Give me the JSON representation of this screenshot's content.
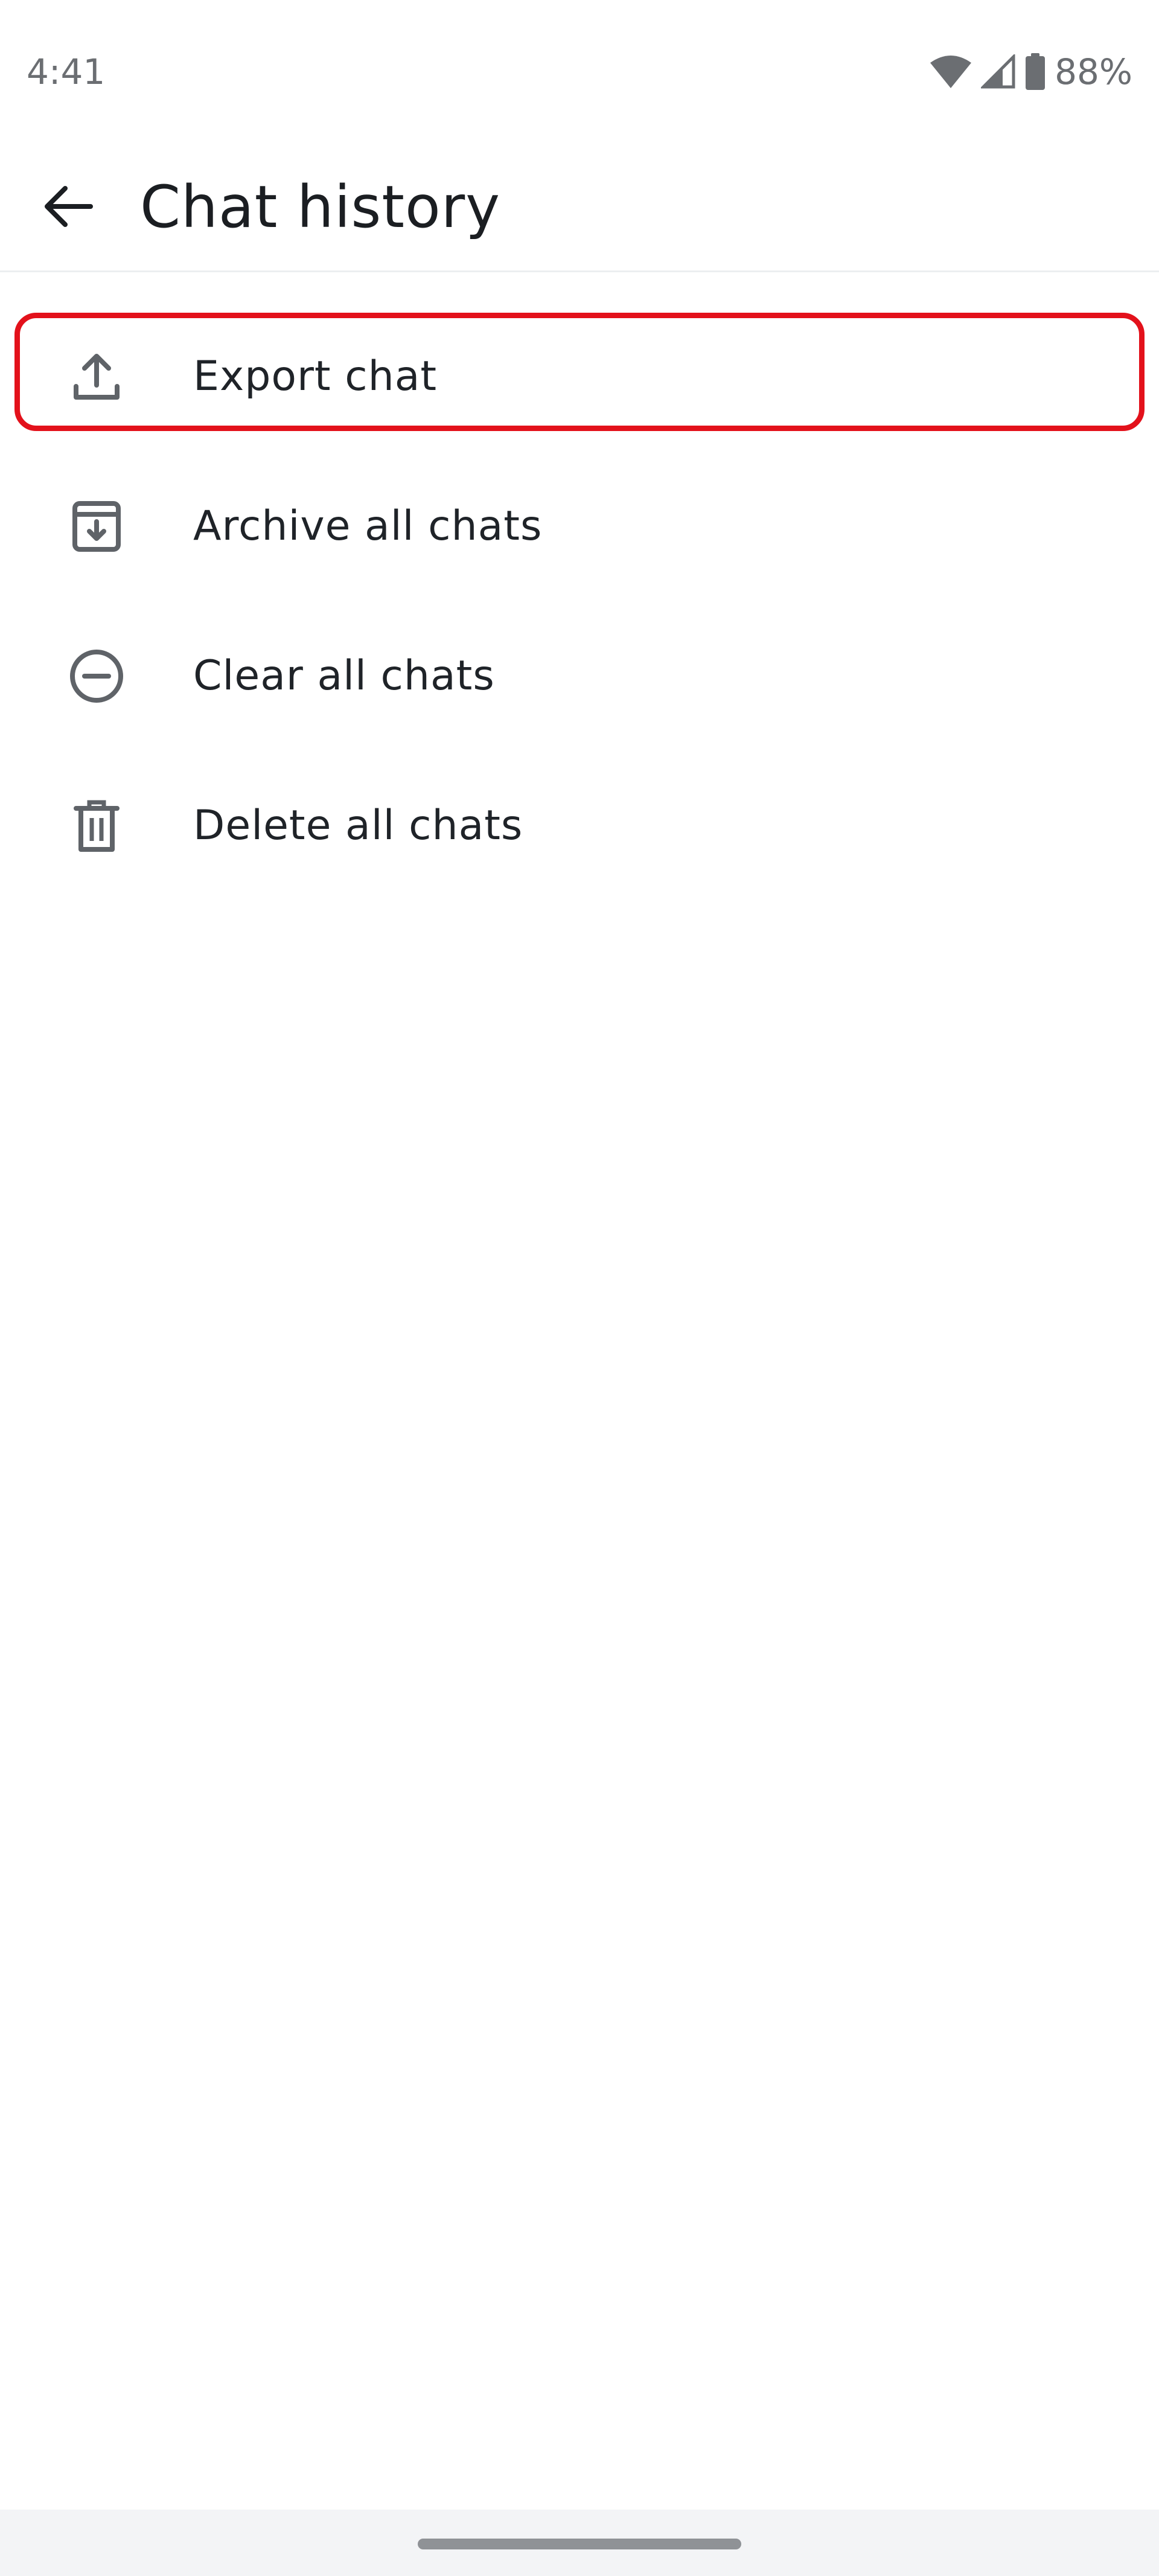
{
  "status_bar": {
    "time": "4:41",
    "battery_percent": "88%",
    "icons": [
      "wifi-icon",
      "cellular-signal-icon",
      "battery-icon"
    ]
  },
  "app_bar": {
    "back_icon": "arrow-left-icon",
    "title": "Chat history"
  },
  "menu": {
    "items": [
      {
        "icon": "upload-icon",
        "label": "Export chat",
        "highlighted": true
      },
      {
        "icon": "archive-icon",
        "label": "Archive all chats",
        "highlighted": false
      },
      {
        "icon": "minus-circle-icon",
        "label": "Clear all chats",
        "highlighted": false
      },
      {
        "icon": "trash-icon",
        "label": "Delete all chats",
        "highlighted": false
      }
    ]
  },
  "colors": {
    "highlight": "#e3111b",
    "icon": "#5f6368",
    "text": "#1f2328",
    "status_text": "#6b6e72"
  }
}
